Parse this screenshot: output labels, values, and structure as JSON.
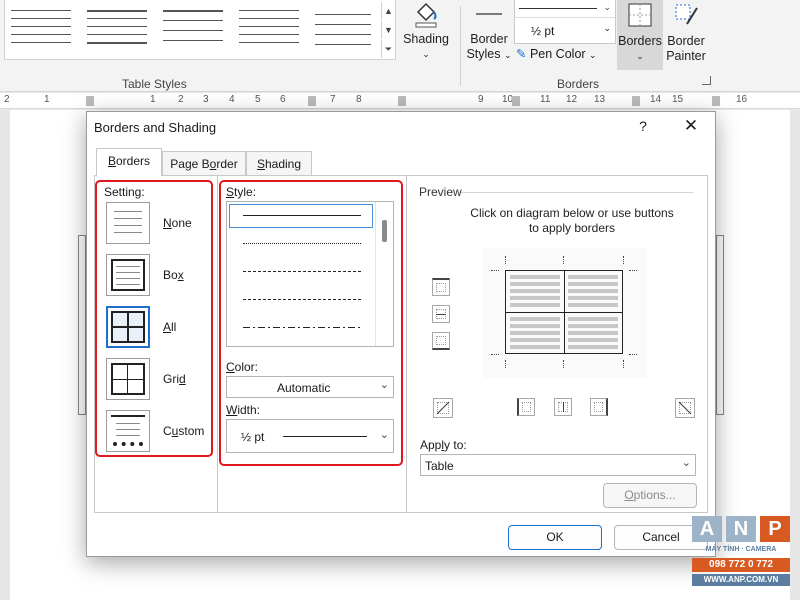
{
  "ribbon": {
    "table_styles_label": "Table Styles",
    "shading_label": "Shading",
    "border_styles_line1": "Border",
    "border_styles_line2": "Styles",
    "pen_weight": "½ pt",
    "pen_color_label": "Pen Color",
    "borders_button_label": "Borders",
    "border_painter_line1": "Border",
    "border_painter_line2": "Painter",
    "borders_group_label": "Borders"
  },
  "ruler": {
    "labels": [
      "2",
      "1",
      "1",
      "2",
      "3",
      "4",
      "5",
      "6",
      "7",
      "8",
      "9",
      "10",
      "11",
      "12",
      "13",
      "14",
      "15",
      "16"
    ]
  },
  "dialog": {
    "title": "Borders and Shading",
    "help_glyph": "?",
    "close_glyph": "✕",
    "tabs": [
      {
        "label_u": "B",
        "label_rest": "orders"
      },
      {
        "label_pre": "Page B",
        "label_u": "o",
        "label_rest": "rder"
      },
      {
        "label_u": "S",
        "label_rest": "hading"
      }
    ],
    "setting": {
      "label": "Setting:",
      "options": [
        {
          "pre": "",
          "u": "N",
          "post": "one"
        },
        {
          "pre": "Bo",
          "u": "x",
          "post": ""
        },
        {
          "pre": "",
          "u": "A",
          "post": "ll"
        },
        {
          "pre": "Gri",
          "u": "d",
          "post": ""
        },
        {
          "pre": "C",
          "u": "u",
          "post": "stom"
        }
      ],
      "selected": "All"
    },
    "style": {
      "label_u": "S",
      "label_rest": "tyle:",
      "line_styles": [
        "solid",
        "dotted",
        "dashed-fine",
        "dashed",
        "dash-dot"
      ]
    },
    "color": {
      "label_u": "C",
      "label_rest": "olor:",
      "value": "Automatic"
    },
    "width": {
      "label_u": "W",
      "label_rest": "idth:",
      "value": "½ pt"
    },
    "preview": {
      "label": "Preview",
      "instruction_line1": "Click on diagram below or use buttons",
      "instruction_line2": "to apply borders"
    },
    "apply_to": {
      "label_pre": "App",
      "label_u": "l",
      "label_rest": "y to:",
      "value": "Table"
    },
    "options_button_pre": "",
    "options_button_u": "O",
    "options_button_rest": "ptions...",
    "ok_label": "OK",
    "cancel_label": "Cancel"
  },
  "watermark": {
    "letters": [
      "A",
      "N",
      "P"
    ],
    "tagline": "MÁY TÍNH · CAMERA",
    "phone": "098 772 0 772",
    "site": "WWW.ANP.COM.VN"
  },
  "colors": {
    "highlight_red": "#e0191f",
    "accent_blue": "#1e6fd0"
  }
}
